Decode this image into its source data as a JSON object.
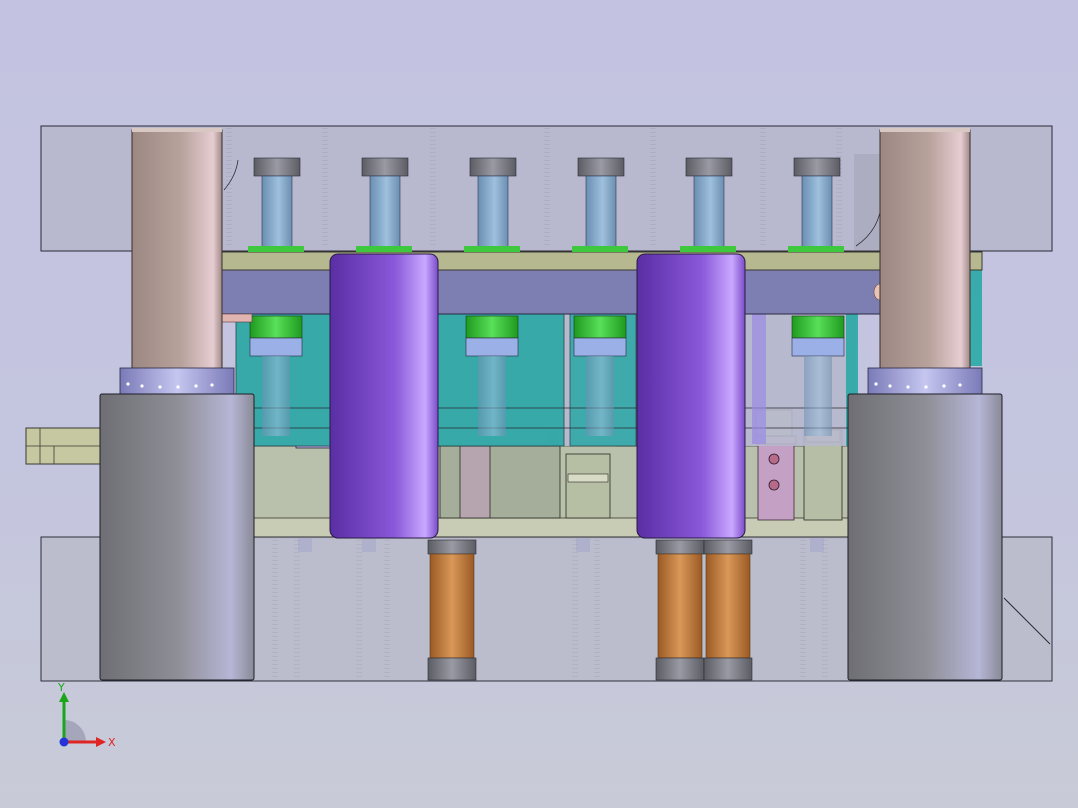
{
  "viewport": {
    "background_top": "#c3c3e1",
    "background_bottom": "#c8cbd7"
  },
  "model": {
    "plate_color": "#b4b4c6",
    "plate_edge_color": "#2a2a34",
    "guide_pillar_color": "#b19a95",
    "guide_bushing_color": "#8f8f9a",
    "main_post_color": "#8a55d8",
    "punch_color": "#8ab0d2",
    "green_ring_color": "#3ec83e",
    "teal_block_color": "#27a9a5",
    "spring_color": "#c07838",
    "stripper_bar_color": "#7d7eb0",
    "beige_plate_color": "#bcbc92"
  },
  "triad": {
    "x_label": "X",
    "y_label": "Y",
    "x_color": "#e02424",
    "y_color": "#1aa61a",
    "z_color": "#2434d8"
  }
}
